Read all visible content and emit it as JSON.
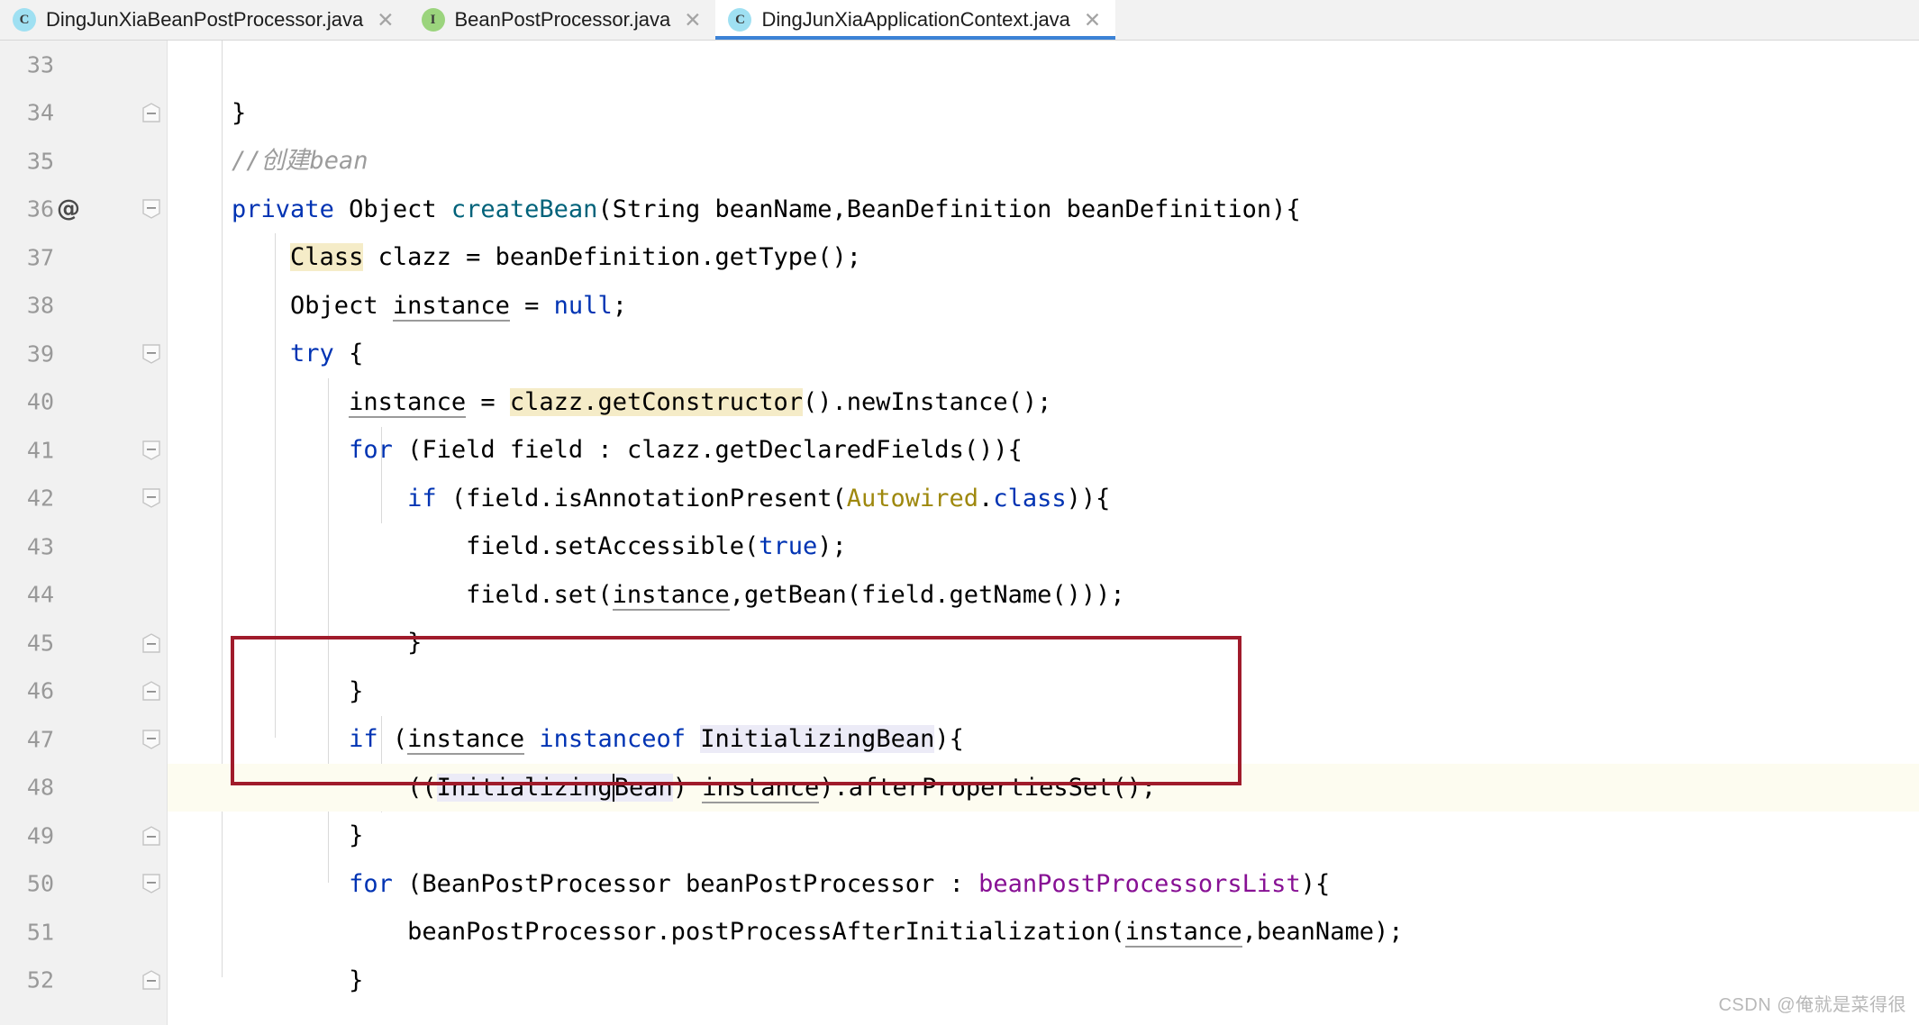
{
  "tabs": [
    {
      "label": "DingJunXiaBeanPostProcessor.java",
      "icon": "class-icon",
      "icon_letter": "C",
      "icon_kind": "cls",
      "active": false,
      "close": "✕"
    },
    {
      "label": "BeanPostProcessor.java",
      "icon": "interface-icon",
      "icon_letter": "I",
      "icon_kind": "iface",
      "active": false,
      "close": "✕"
    },
    {
      "label": "DingJunXiaApplicationContext.java",
      "icon": "class-icon",
      "icon_letter": "C",
      "icon_kind": "cls",
      "active": true,
      "close": "✕"
    }
  ],
  "gutter": {
    "line_numbers": [
      "33",
      "34",
      "35",
      "36",
      "37",
      "38",
      "39",
      "40",
      "41",
      "42",
      "43",
      "44",
      "45",
      "46",
      "47",
      "48",
      "49",
      "50",
      "51",
      "52"
    ],
    "annotation_marker": "@",
    "annotation_line": "36"
  },
  "editor": {
    "caret_line": "48",
    "language": "java",
    "file": "DingJunXiaApplicationContext.java",
    "lines": [
      {
        "n": "33",
        "text": ""
      },
      {
        "n": "34",
        "text": "    }"
      },
      {
        "n": "35",
        "text": "    //创建bean"
      },
      {
        "n": "36",
        "text": "    private Object createBean(String beanName,BeanDefinition beanDefinition){"
      },
      {
        "n": "37",
        "text": "        Class clazz = beanDefinition.getType();"
      },
      {
        "n": "38",
        "text": "        Object instance = null;"
      },
      {
        "n": "39",
        "text": "        try {"
      },
      {
        "n": "40",
        "text": "            instance = clazz.getConstructor().newInstance();"
      },
      {
        "n": "41",
        "text": "            for (Field field : clazz.getDeclaredFields()){"
      },
      {
        "n": "42",
        "text": "                if (field.isAnnotationPresent(Autowired.class)){"
      },
      {
        "n": "43",
        "text": "                    field.setAccessible(true);"
      },
      {
        "n": "44",
        "text": "                    field.set(instance,getBean(field.getName()));"
      },
      {
        "n": "45",
        "text": "                }"
      },
      {
        "n": "46",
        "text": "            }"
      },
      {
        "n": "47",
        "text": "            if (instance instanceof InitializingBean){"
      },
      {
        "n": "48",
        "text": "                ((InitializingBean) instance).afterPropertiesSet();"
      },
      {
        "n": "49",
        "text": "            }"
      },
      {
        "n": "50",
        "text": "            for (BeanPostProcessor beanPostProcessor : beanPostProcessorsList){"
      },
      {
        "n": "51",
        "text": "                beanPostProcessor.postProcessAfterInitialization(instance,beanName);"
      },
      {
        "n": "52",
        "text": "            }"
      }
    ]
  },
  "annotation_box": {
    "name": "red-highlight-box",
    "color": "#a01b2b",
    "covers_lines": [
      "50",
      "51",
      "52"
    ]
  },
  "watermark": {
    "text": "CSDN @俺就是菜得很"
  },
  "colors": {
    "keyword": "#0033b3",
    "method": "#00627a",
    "field": "#871094",
    "annotation": "#9e880d",
    "comment": "#9c9c9c",
    "search_highlight": "#f5ecc8",
    "identifier_highlight": "#ecebf7",
    "tab_active_underline": "#3b82d6",
    "gutter_bg": "#f1f1f1",
    "caret_line_bg": "#fdfcf0"
  }
}
